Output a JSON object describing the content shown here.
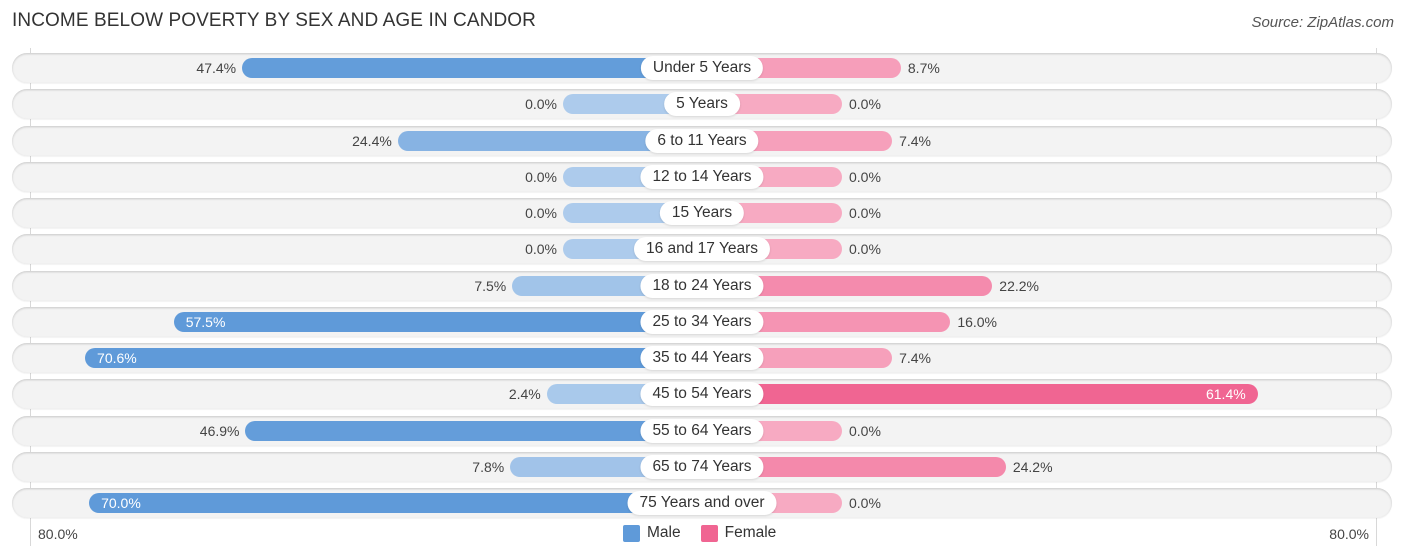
{
  "header": {
    "title": "INCOME BELOW POVERTY BY SEX AND AGE IN CANDOR",
    "source": "Source: ZipAtlas.com"
  },
  "colors": {
    "male_strong": "#5f9ad9",
    "male_light": "#adcbec",
    "female_strong": "#f06592",
    "female_light": "#f7aac2",
    "row_bg": "#f3f3f3"
  },
  "chart_data": {
    "type": "bar",
    "orientation": "horizontal-diverging",
    "title": "INCOME BELOW POVERTY BY SEX AND AGE IN CANDOR",
    "categories": [
      "Under 5 Years",
      "5 Years",
      "6 to 11 Years",
      "12 to 14 Years",
      "15 Years",
      "16 and 17 Years",
      "18 to 24 Years",
      "25 to 34 Years",
      "35 to 44 Years",
      "45 to 54 Years",
      "55 to 64 Years",
      "65 to 74 Years",
      "75 Years and over"
    ],
    "series": [
      {
        "name": "Male",
        "values": [
          47.4,
          0.0,
          24.4,
          0.0,
          0.0,
          0.0,
          7.5,
          57.5,
          70.6,
          2.4,
          46.9,
          7.8,
          70.0
        ],
        "labels": [
          "47.4%",
          "0.0%",
          "24.4%",
          "0.0%",
          "0.0%",
          "0.0%",
          "7.5%",
          "57.5%",
          "70.6%",
          "2.4%",
          "46.9%",
          "7.8%",
          "70.0%"
        ]
      },
      {
        "name": "Female",
        "values": [
          8.7,
          0.0,
          7.4,
          0.0,
          0.0,
          0.0,
          22.2,
          16.0,
          7.4,
          61.4,
          0.0,
          24.2,
          0.0
        ],
        "labels": [
          "8.7%",
          "0.0%",
          "7.4%",
          "0.0%",
          "0.0%",
          "0.0%",
          "22.2%",
          "16.0%",
          "7.4%",
          "61.4%",
          "0.0%",
          "24.2%",
          "0.0%"
        ]
      }
    ],
    "xlim": [
      -80,
      80
    ],
    "axis_labels": {
      "left": "80.0%",
      "right": "80.0%"
    },
    "legend": {
      "position": "bottom-center",
      "entries": [
        "Male",
        "Female"
      ]
    },
    "grid": false
  }
}
